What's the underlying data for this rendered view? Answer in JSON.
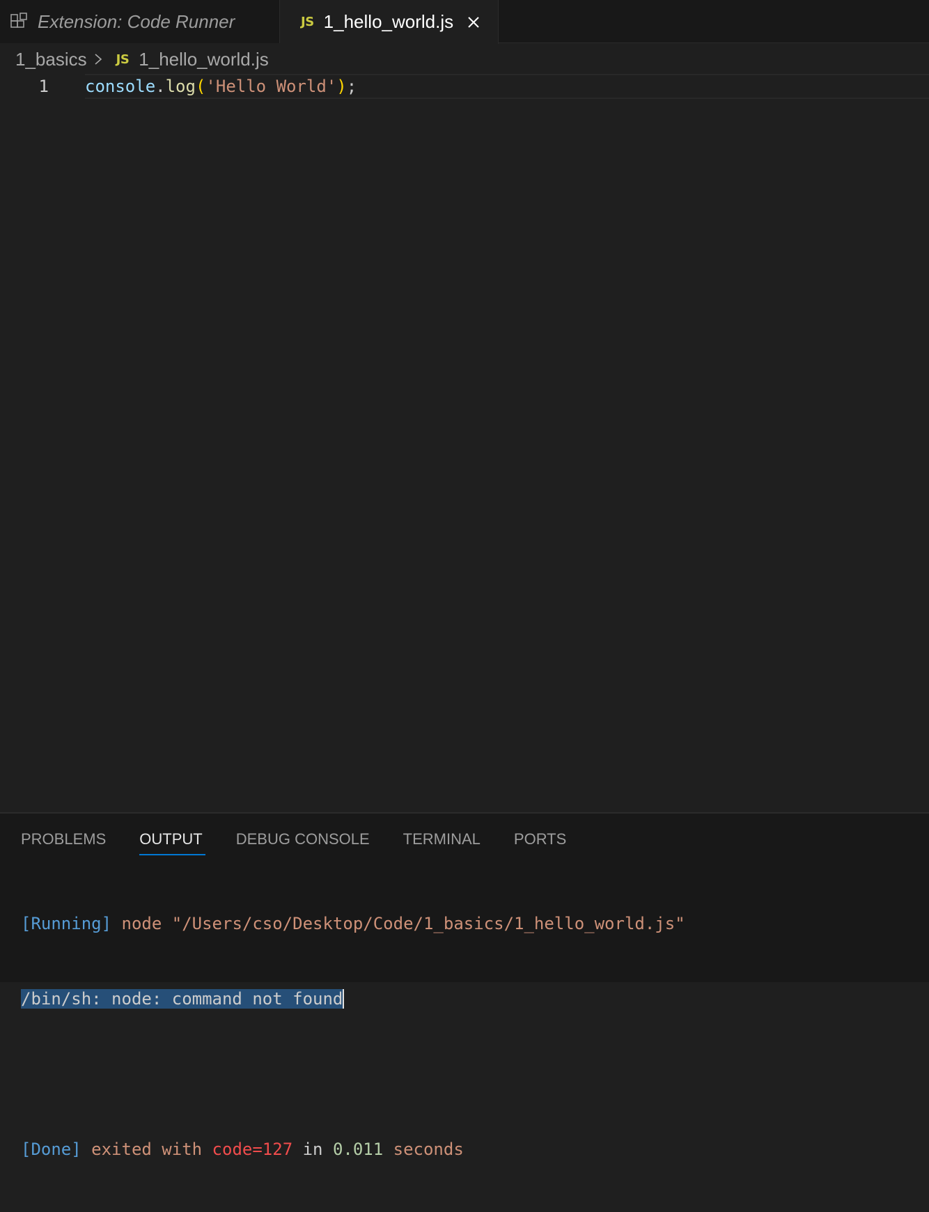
{
  "tabs": [
    {
      "label": "Extension: Code Runner",
      "icon": "extensions-icon",
      "active": false
    },
    {
      "label": "1_hello_world.js",
      "badge": "JS",
      "active": true,
      "close_icon": "close-icon"
    }
  ],
  "breadcrumb": {
    "folder": "1_basics",
    "badge": "JS",
    "file": "1_hello_world.js"
  },
  "editor": {
    "line_number": "1",
    "code": {
      "obj": "console",
      "dot": ".",
      "fn": "log",
      "open": "(",
      "str": "'Hello World'",
      "close": ")",
      "semi": ";"
    }
  },
  "panel": {
    "tabs": [
      "PROBLEMS",
      "OUTPUT",
      "DEBUG CONSOLE",
      "TERMINAL",
      "PORTS"
    ],
    "active_tab": "OUTPUT",
    "output": {
      "line1_tag": "[Running]",
      "line1_text": " node \"/Users/cso/Desktop/Code/1_basics/1_hello_world.js\"",
      "line2_selected": "/bin/sh: node: command not found",
      "line4_tag": "[Done]",
      "line4_t1": " exited with ",
      "line4_code": "code=127",
      "line4_t2": " in ",
      "line4_time": "0.011",
      "line4_t3": " seconds"
    }
  },
  "colors": {
    "js_badge": "#cbcb41",
    "active_tab_underline": "#0078d4",
    "selection": "#264f78"
  }
}
